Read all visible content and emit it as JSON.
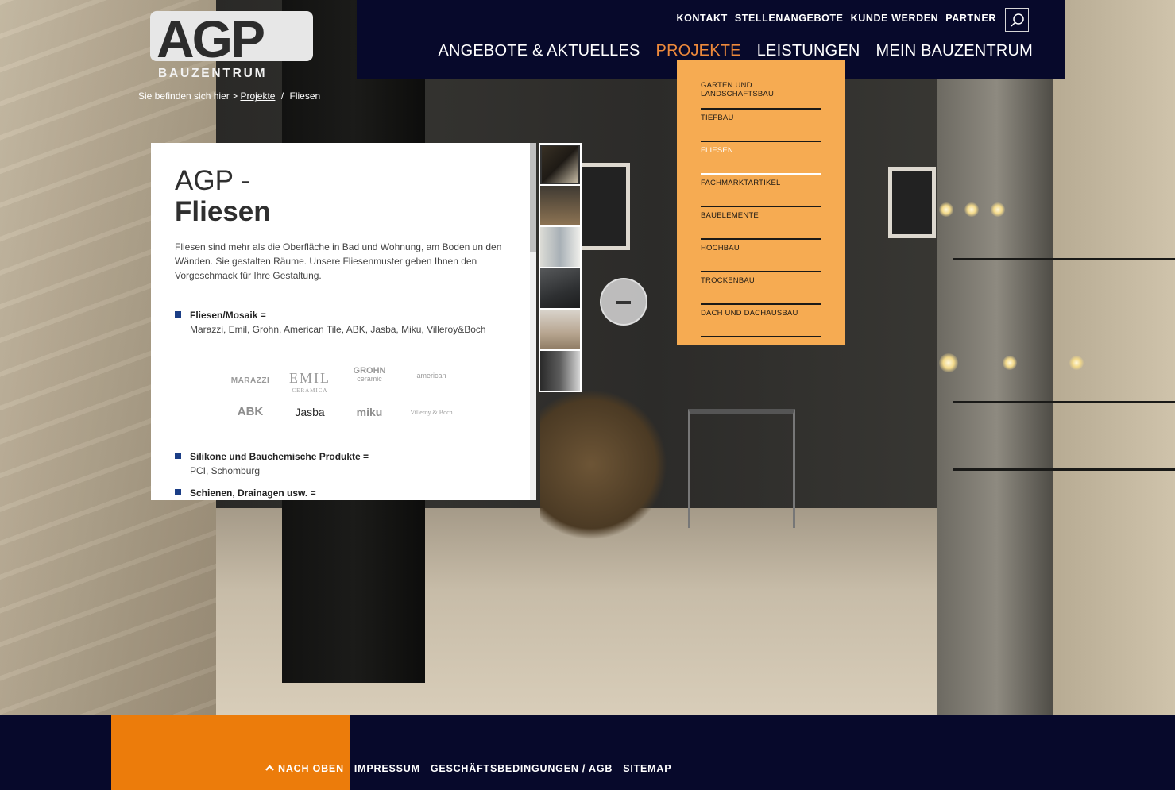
{
  "logo": {
    "main": "AGP",
    "sub": "BAUZENTRUM"
  },
  "breadcrumb": {
    "prefix": "Sie befinden sich hier >",
    "link": "Projekte",
    "separator": "/",
    "current": "Fliesen"
  },
  "topnav": [
    "KONTAKT",
    "STELLENANGEBOTE",
    "KUNDE WERDEN",
    "PARTNER"
  ],
  "mainnav": [
    {
      "label": "ANGEBOTE & AKTUELLES",
      "active": false
    },
    {
      "label": "PROJEKTE",
      "active": true
    },
    {
      "label": "LEISTUNGEN",
      "active": false
    },
    {
      "label": "MEIN BAUZENTRUM",
      "active": false
    }
  ],
  "dropdown": [
    {
      "label": "GARTEN UND LANDSCHAFTSBAU",
      "active": false
    },
    {
      "label": "TIEFBAU",
      "active": false
    },
    {
      "label": "FLIESEN",
      "active": true
    },
    {
      "label": "FACHMARKTARTIKEL",
      "active": false
    },
    {
      "label": "BAUELEMENTE",
      "active": false
    },
    {
      "label": "HOCHBAU",
      "active": false
    },
    {
      "label": "TROCKENBAU",
      "active": false
    },
    {
      "label": "DACH UND DACHAUSBAU",
      "active": false
    }
  ],
  "content": {
    "title_line1": "AGP -",
    "title_line2": "Fliesen",
    "intro": "Fliesen sind mehr als die Oberfläche in Bad und Wohnung, am Boden un den Wänden. Sie gestalten Räume. Unsere Fliesenmuster geben Ihnen den Vorgeschmack für Ihre Gestaltung.",
    "bullets": [
      {
        "head": "Fliesen/Mosaik =",
        "text": "Marazzi, Emil, Grohn, American Tile, ABK, Jasba, Miku, Villeroy&Boch"
      },
      {
        "head": "Silikone und Bauchemische Produkte =",
        "text": "PCI, Schomburg"
      },
      {
        "head": "Schienen, Drainagen usw. =",
        "text": ""
      }
    ],
    "brands": [
      "MARAZZI",
      "EMIL",
      "GROHN",
      "american",
      "ABK",
      "Jasba",
      "miku",
      "Villeroy & Boch"
    ],
    "brand_subs": {
      "emil": "CERAMICA",
      "grohn": "ceramic"
    }
  },
  "footer": {
    "up": "NACH OBEN",
    "links": [
      "IMPRESSUM",
      "GESCHÄFTSBEDINGUNGEN / AGB",
      "SITEMAP"
    ]
  },
  "colors": {
    "navy": "#07092b",
    "orange": "#ec7c0b",
    "dropdown": "#f6ab52",
    "active_nav": "#ee8a3b",
    "bullet": "#1b3e86"
  },
  "icons": {
    "search": "search-icon",
    "zoom": "minus-icon",
    "up": "chevron-up-icon"
  }
}
